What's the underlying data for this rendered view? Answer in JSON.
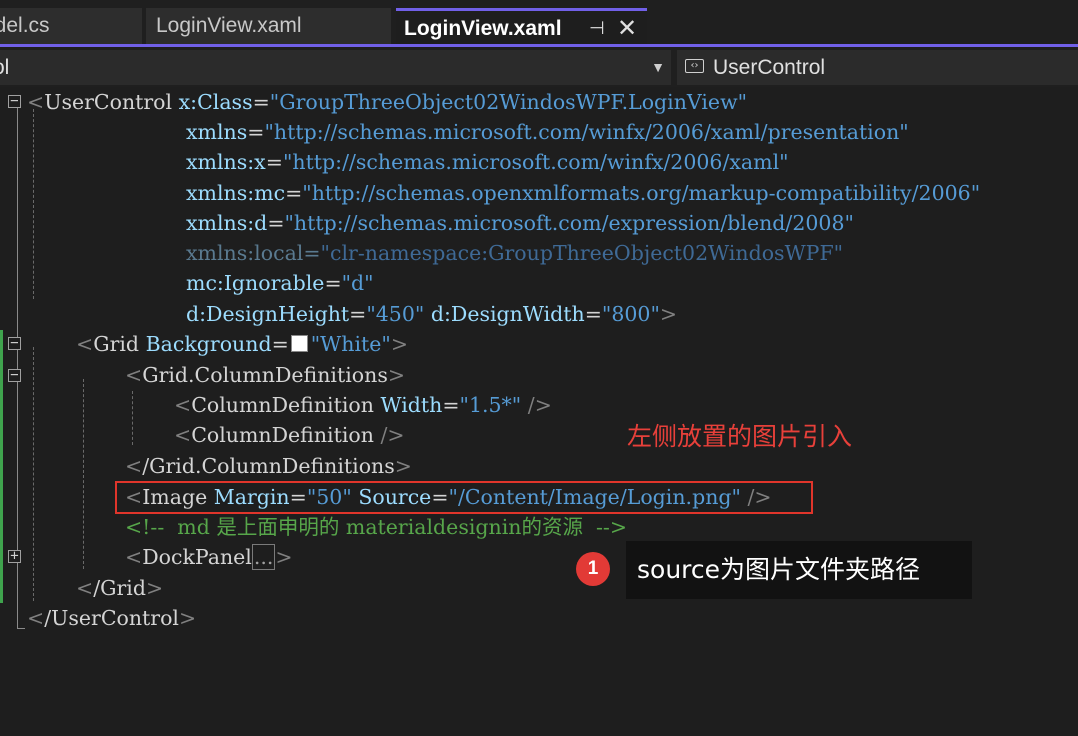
{
  "tabs": [
    {
      "label": "odel.cs",
      "active": false
    },
    {
      "label": "LoginView.xaml",
      "active": false
    },
    {
      "label": "LoginView.xaml",
      "active": true
    }
  ],
  "tab_icons": {
    "pin": "pin-icon",
    "close": "close-icon"
  },
  "navbar": {
    "left_label": "ol",
    "right_label": "UserControl",
    "right_icon": "control-icon"
  },
  "code": {
    "l1": {
      "tag": "UserControl",
      "attr": "x:Class",
      "value": "\"GroupThreeObject02WindosWPF.LoginView\""
    },
    "l2": {
      "attr": "xmlns",
      "value": "\"http://schemas.microsoft.com/winfx/2006/xaml/presentation\""
    },
    "l3": {
      "attr": "xmlns:x",
      "value": "\"http://schemas.microsoft.com/winfx/2006/xaml\""
    },
    "l4": {
      "attr": "xmlns:mc",
      "value": "\"http://schemas.openxmlformats.org/markup-compatibility/2006\""
    },
    "l5": {
      "attr": "xmlns:d",
      "value": "\"http://schemas.microsoft.com/expression/blend/2008\""
    },
    "l6": {
      "attr": "xmlns:local",
      "value": "\"clr-namespace:GroupThreeObject02WindosWPF\""
    },
    "l7": {
      "attr": "mc:Ignorable",
      "value": "\"d\""
    },
    "l8": {
      "attr1": "d:DesignHeight",
      "value1": "\"450\"",
      "attr2": "d:DesignWidth",
      "value2": "\"800\""
    },
    "l9": {
      "tag": "Grid",
      "attr": "Background",
      "value": "\"White\""
    },
    "l10": {
      "tag": "Grid.ColumnDefinitions"
    },
    "l11": {
      "tag": "ColumnDefinition",
      "attr": "Width",
      "value": "\"1.5*\""
    },
    "l12": {
      "tag": "ColumnDefinition"
    },
    "l13": {
      "tag": "/Grid.ColumnDefinitions"
    },
    "l14": {
      "tag": "Image",
      "attr1": "Margin",
      "value1": "\"50\"",
      "attr2": "Source",
      "value2": "\"/Content/Image/Login.png\""
    },
    "l15": {
      "comment": "<!--  md 是上面申明的 materialdesignin的资源  -->"
    },
    "l16": {
      "tag": "DockPanel",
      "collapsed": "..."
    },
    "l17": {
      "tag": "/Grid"
    },
    "l18": {
      "tag": "/UserControl"
    }
  },
  "annotation": {
    "label": "左侧放置的图片引入",
    "badge_number": "1",
    "tooltip": "source为图片文件夹路径",
    "color": "#e23a36"
  },
  "colors": {
    "accent": "#7160e8",
    "attribute": "#9cdcfe",
    "value": "#569cd6",
    "comment": "#57a64a",
    "change_bar": "#3fa34d"
  }
}
